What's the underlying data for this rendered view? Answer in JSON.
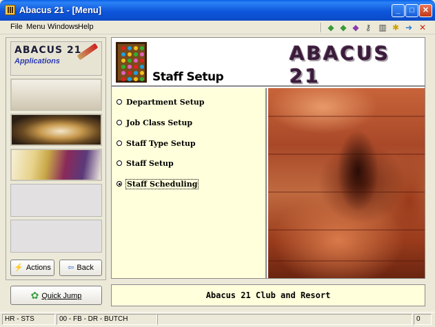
{
  "window": {
    "title": "Abacus 21 - [Menu]",
    "minimize": "_",
    "maximize": "□",
    "close": "✕"
  },
  "menu": {
    "items": [
      "File",
      "Menu",
      "Windows",
      "Help"
    ]
  },
  "toolbar": {
    "icons": [
      {
        "name": "back-arrow-icon",
        "glyph": "◆",
        "color": "#3a9a3a"
      },
      {
        "name": "forward-arrow-icon",
        "glyph": "◆",
        "color": "#3a9a3a"
      },
      {
        "name": "book-icon",
        "glyph": "◆",
        "color": "#8a3ab0"
      },
      {
        "name": "key-icon",
        "glyph": "⚷",
        "color": "#505050"
      },
      {
        "name": "calculator-icon",
        "glyph": "▥",
        "color": "#404040"
      },
      {
        "name": "person-icon",
        "glyph": "✱",
        "color": "#d0a000"
      },
      {
        "name": "exit-door-icon",
        "glyph": "➜",
        "color": "#2a7ad0"
      },
      {
        "name": "close-red-icon",
        "glyph": "✕",
        "color": "#d02010"
      }
    ]
  },
  "sidebar": {
    "logo_title": "ABACUS 21",
    "logo_subtitle": "Applications",
    "actions_label": "Actions",
    "back_label": "Back",
    "quick_jump_label": "Quick Jump"
  },
  "main": {
    "section_title": "Staff Setup",
    "brand": "ABACUS 21",
    "options": [
      {
        "label": "Department Setup",
        "selected": false
      },
      {
        "label": "Job Class Setup",
        "selected": false
      },
      {
        "label": "Staff Type Setup",
        "selected": false
      },
      {
        "label": "Staff Setup",
        "selected": false
      },
      {
        "label": "Staff Scheduling",
        "selected": true
      }
    ],
    "banner": "Abacus 21 Club and Resort"
  },
  "status": {
    "left": "HR - STS",
    "middle": "00 - FB - DR - BUTCH",
    "right": "0"
  }
}
